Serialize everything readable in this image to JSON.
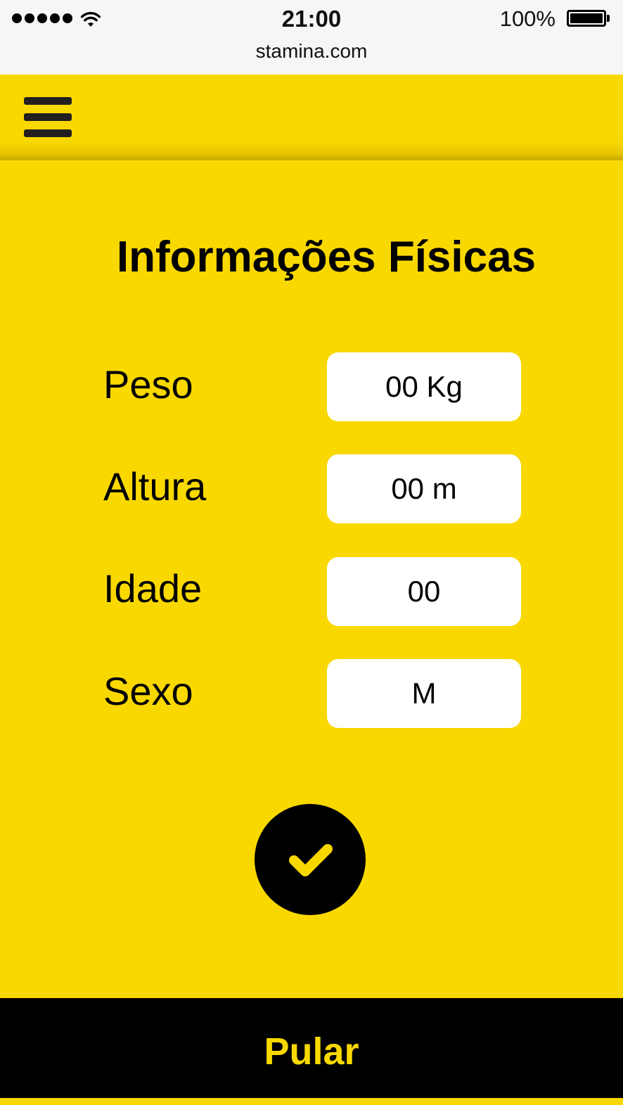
{
  "status_bar": {
    "time": "21:00",
    "url": "stamina.com",
    "battery": "100%"
  },
  "header": {
    "menu_icon": "hamburger-menu-icon"
  },
  "form": {
    "title": "Informações Físicas",
    "fields": [
      {
        "label": "Peso",
        "value": "00 Kg"
      },
      {
        "label": "Altura",
        "value": "00 m"
      },
      {
        "label": "Idade",
        "value": "00"
      },
      {
        "label": "Sexo",
        "value": "M"
      }
    ],
    "confirm_icon": "checkmark-icon"
  },
  "footer": {
    "skip_label": "Pular"
  },
  "colors": {
    "brand_yellow": "#F9D800",
    "dark": "#000000"
  }
}
